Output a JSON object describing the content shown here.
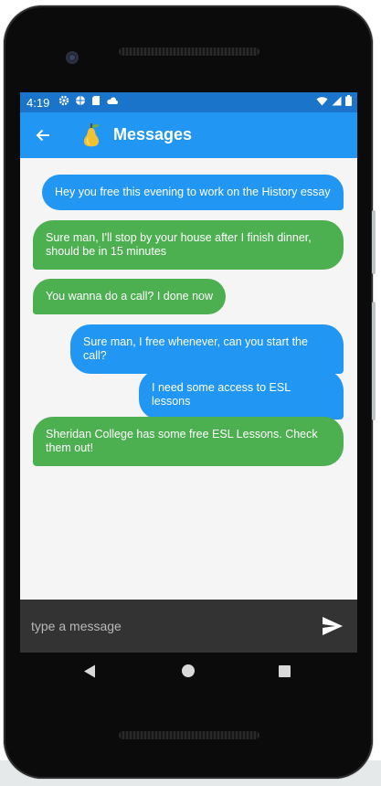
{
  "status_bar": {
    "time": "4:19",
    "left_icons": [
      "gear-icon",
      "globe-icon",
      "sd-card-icon",
      "cloud-icon"
    ],
    "right_icons": [
      "wifi-icon",
      "signal-icon",
      "battery-icon"
    ]
  },
  "app_bar": {
    "title": "Messages",
    "logo": "pear-icon",
    "accent": "#2196f3"
  },
  "messages": [
    {
      "from": "me",
      "text": "Hey you free this evening to work on the History essay"
    },
    {
      "from": "other",
      "text": "Sure man, I'll stop by your house after I finish dinner, should be in 15 minutes"
    },
    {
      "from": "other",
      "text": "You wanna do a call? I done now"
    },
    {
      "from": "me",
      "text": "Sure man, I free whenever, can you start the call?"
    },
    {
      "from": "me",
      "text": "I need some access to ESL lessons"
    },
    {
      "from": "other",
      "text": "Sheridan College has some free ESL Lessons. Check them out!"
    }
  ],
  "colors": {
    "sent_bubble": "#2196f3",
    "received_bubble": "#4caf50",
    "input_bar": "#333333"
  },
  "composer": {
    "placeholder": "type a message",
    "value": ""
  }
}
